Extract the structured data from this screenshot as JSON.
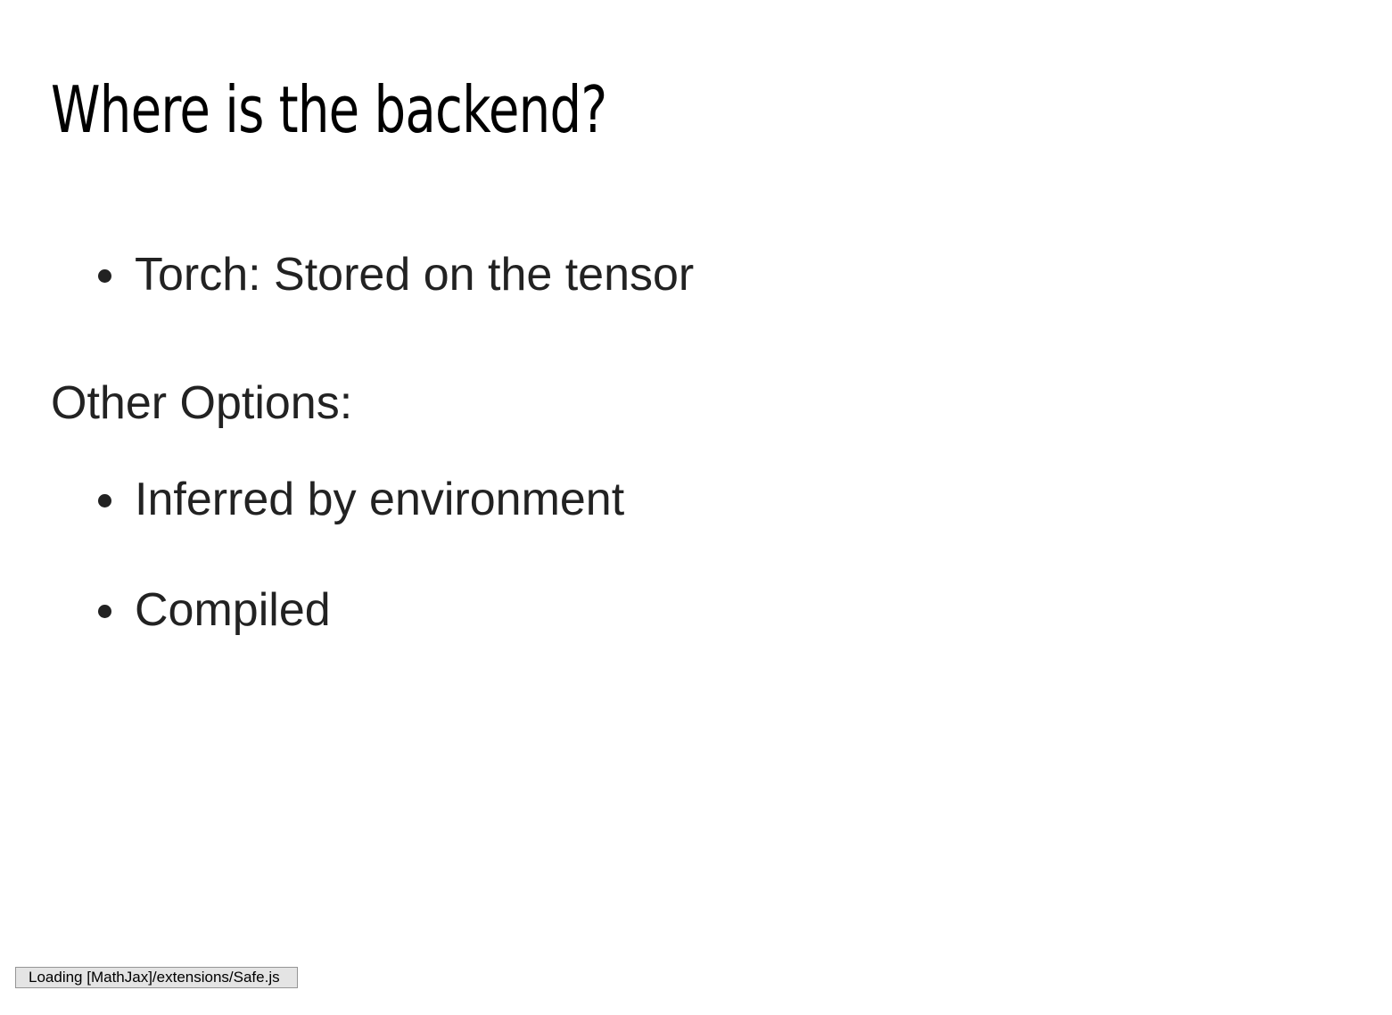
{
  "slide": {
    "title": "Where is the backend?",
    "bullets_top": [
      {
        "label": "Torch: Stored on the tensor"
      }
    ],
    "section_heading": "Other Options:",
    "bullets_bottom": [
      {
        "label": "Inferred by environment"
      },
      {
        "label": "Compiled"
      }
    ]
  },
  "status": {
    "message": "Loading [MathJax]/extensions/Safe.js"
  },
  "colors": {
    "title": "#000000",
    "body_text": "#222222",
    "status_bg": "#e4e4e4",
    "status_border": "#959595",
    "background": "#ffffff"
  }
}
